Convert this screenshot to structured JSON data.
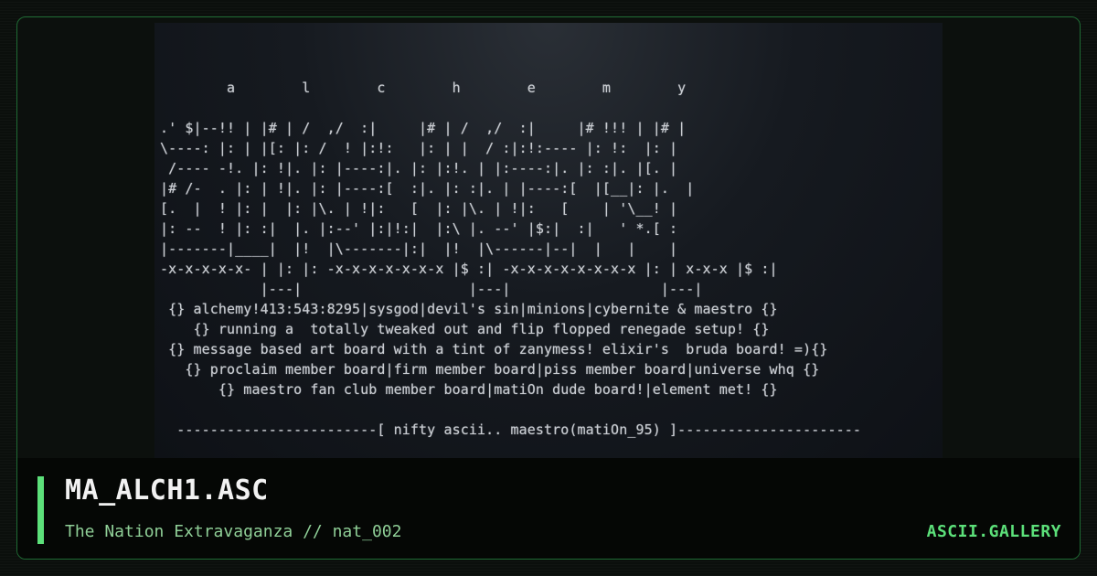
{
  "art": {
    "text": "        a        l        c        h        e        m        y\n\n.' $|--!! | |# | /  ,/  :|     |# | /  ,/  :|     |# !!! | |# |\n\\----: |: | |[: |: /  ! |:!:   |: | |  / :|:!:---- |: !:  |: |\n /---- -!. |: !|. |: |----:|. |: |:!. | |:----:|. |: :|. |[. |\n|# /-  . |: | !|. |: |----:[  :|. |: :|. | |----:[  |[__|: |.  |\n[.  |  ! |: |  |: |\\. | !|:   [  |: |\\. | !|:   [    | '\\__! |\n|: --  ! |: :|  |. |:--' |:|!:|  |:\\ |. --' |$:|  :|   ' *.[ :\n|-------|____|  |!  |\\-------|:|  |!  |\\------|--|  |   |    |\n-x-x-x-x-x- | |: |: -x-x-x-x-x-x-x |$ :| -x-x-x-x-x-x-x-x |: | x-x-x |$ :|\n            |---|                    |---|                  |---|\n {} alchemy!413:543:8295|sysgod|devil's sin|minions|cybernite & maestro {}\n    {} running a  totally tweaked out and flip flopped renegade setup! {}\n {} message based art board with a tint of zanymess! elixir's  bruda board! =){}\n   {} proclaim member board|firm member board|piss member board|universe whq {}\n       {} maestro fan club member board|matiOn dude board!|element met! {}\n\n  ------------------------[ nifty ascii.. maestro(matiOn_95) ]----------------------"
  },
  "footer": {
    "title": "MA_ALCH1.ASC",
    "subtitle": "The Nation Extravaganza // nat_002",
    "brand": "ASCII.GALLERY"
  },
  "colors": {
    "accent": "#5ce07a",
    "border": "#1f6b34",
    "background": "#0b0f0c"
  }
}
